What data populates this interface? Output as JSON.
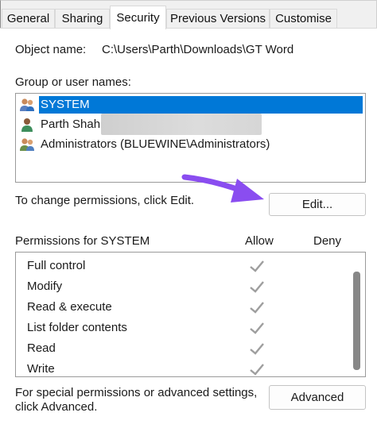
{
  "tabs": [
    {
      "label": "General",
      "active": false
    },
    {
      "label": "Sharing",
      "active": false
    },
    {
      "label": "Security",
      "active": true
    },
    {
      "label": "Previous Versions",
      "active": false
    },
    {
      "label": "Customise",
      "active": false
    }
  ],
  "object": {
    "label": "Object name:",
    "value": "C:\\Users\\Parth\\Downloads\\GT Word"
  },
  "group_names_label": "Group or user names:",
  "users": [
    {
      "name": "SYSTEM",
      "icon": "users-group-icon",
      "selected": true
    },
    {
      "name": "Parth Shah (",
      "icon": "user-icon",
      "selected": false
    },
    {
      "name": "Administrators (BLUEWINE\\Administrators)",
      "icon": "users-group-icon",
      "selected": false
    }
  ],
  "change_permissions_text": "To change permissions, click Edit.",
  "edit_button": "Edit...",
  "permissions": {
    "header": "Permissions for SYSTEM",
    "allow_header": "Allow",
    "deny_header": "Deny",
    "rows": [
      {
        "name": "Full control",
        "allow": true,
        "deny": false
      },
      {
        "name": "Modify",
        "allow": true,
        "deny": false
      },
      {
        "name": "Read & execute",
        "allow": true,
        "deny": false
      },
      {
        "name": "List folder contents",
        "allow": true,
        "deny": false
      },
      {
        "name": "Read",
        "allow": true,
        "deny": false
      },
      {
        "name": "Write",
        "allow": true,
        "deny": false
      }
    ]
  },
  "advanced": {
    "text_line1": "For special permissions or advanced settings,",
    "text_line2": "click Advanced.",
    "button": "Advanced"
  },
  "colors": {
    "selection": "#0078d7",
    "annotation_arrow": "#8a4df0",
    "check_grey": "#9e9e9e"
  }
}
